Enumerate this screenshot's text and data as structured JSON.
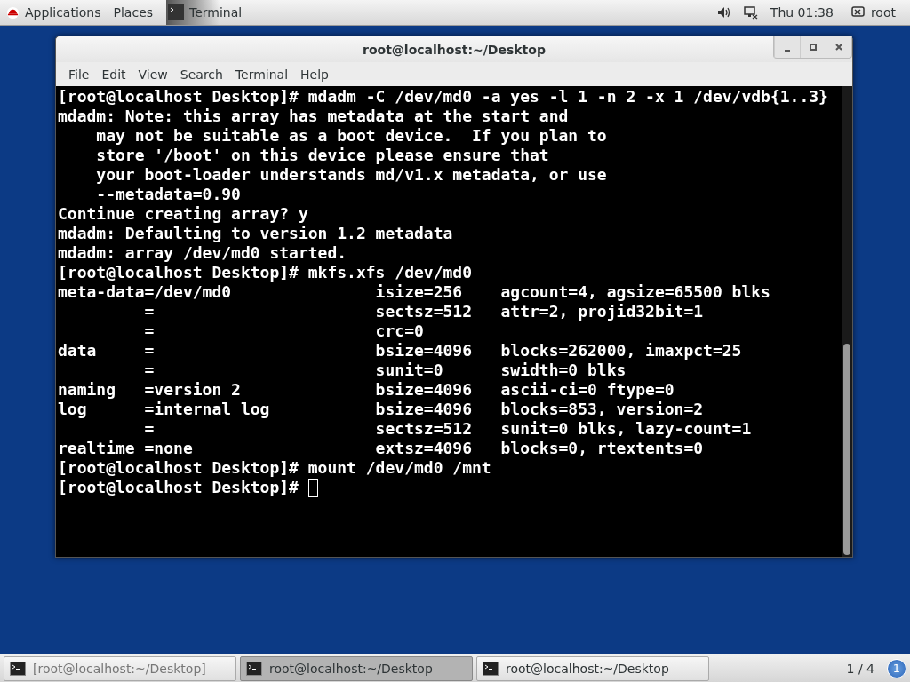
{
  "top_bar": {
    "menus": [
      {
        "label": "Applications",
        "kind": "applications"
      },
      {
        "label": "Places",
        "kind": "plain"
      },
      {
        "label": "Terminal",
        "kind": "app"
      }
    ],
    "clock": "Thu 01:38",
    "user": "root"
  },
  "window": {
    "title": "root@localhost:~/Desktop",
    "menu": [
      "File",
      "Edit",
      "View",
      "Search",
      "Terminal",
      "Help"
    ],
    "terminal": {
      "lines": [
        "[root@localhost Desktop]# mdadm -C /dev/md0 -a yes -l 1 -n 2 -x 1 /dev/vdb{1..3}",
        "mdadm: Note: this array has metadata at the start and",
        "    may not be suitable as a boot device.  If you plan to",
        "    store '/boot' on this device please ensure that",
        "    your boot-loader understands md/v1.x metadata, or use",
        "    --metadata=0.90",
        "Continue creating array? y",
        "mdadm: Defaulting to version 1.2 metadata",
        "mdadm: array /dev/md0 started.",
        "[root@localhost Desktop]# mkfs.xfs /dev/md0",
        "meta-data=/dev/md0               isize=256    agcount=4, agsize=65500 blks",
        "         =                       sectsz=512   attr=2, projid32bit=1",
        "         =                       crc=0",
        "data     =                       bsize=4096   blocks=262000, imaxpct=25",
        "         =                       sunit=0      swidth=0 blks",
        "naming   =version 2              bsize=4096   ascii-ci=0 ftype=0",
        "log      =internal log           bsize=4096   blocks=853, version=2",
        "         =                       sectsz=512   sunit=0 blks, lazy-count=1",
        "realtime =none                   extsz=4096   blocks=0, rtextents=0",
        "[root@localhost Desktop]# mount /dev/md0 /mnt",
        "[root@localhost Desktop]# "
      ],
      "cursor": true
    }
  },
  "taskbar": {
    "items": [
      {
        "label": "[root@localhost:~/Desktop]",
        "selected": false,
        "minimized": true
      },
      {
        "label": "root@localhost:~/Desktop",
        "selected": true,
        "minimized": false
      },
      {
        "label": "root@localhost:~/Desktop",
        "selected": false,
        "minimized": false
      }
    ],
    "workspace": "1 / 4",
    "notifications": "1"
  }
}
